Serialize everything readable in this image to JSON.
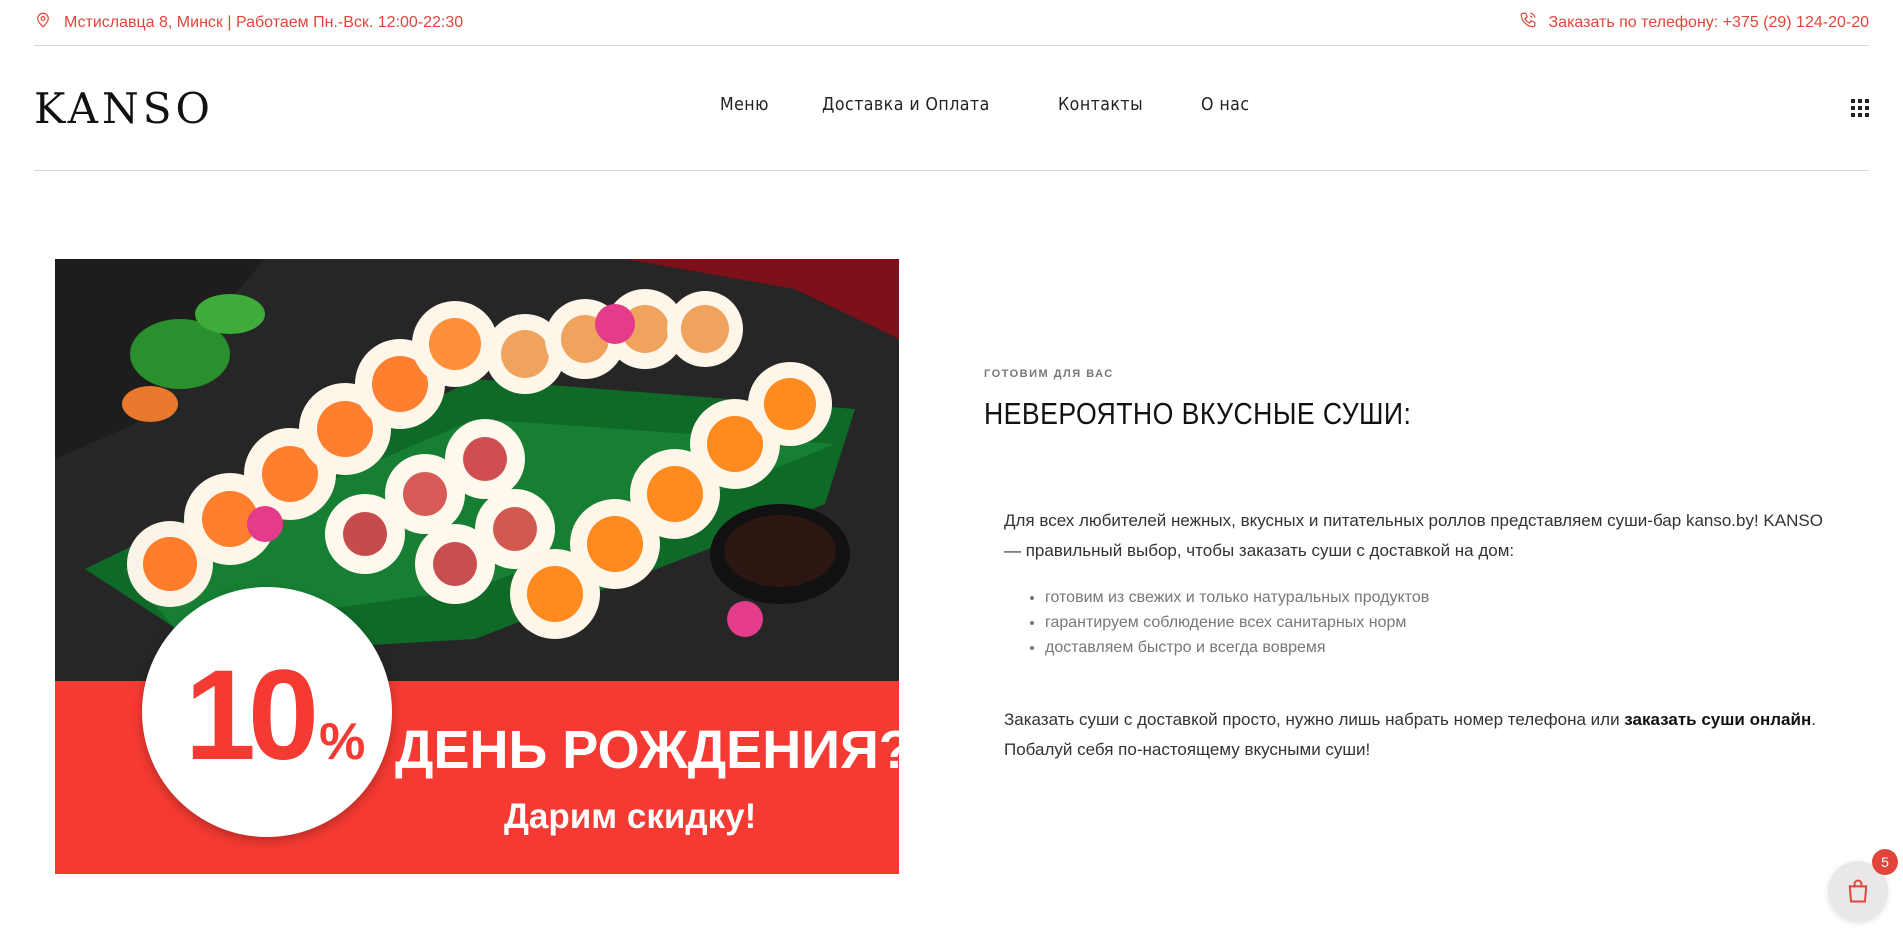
{
  "topbar": {
    "address": "Мстиславца 8, Минск | Работаем Пн.-Вск. 12:00-22:30",
    "phone_text": "Заказать по телефону: +375 (29) 124-20-20",
    "address_icon": "location-pin-icon",
    "phone_icon": "phone-icon",
    "accent_color": "#e0463b"
  },
  "header": {
    "logo": "KANSO",
    "nav": [
      "Меню",
      "Доставка и Оплата",
      "Контакты",
      "О нас"
    ],
    "menu_icon": "grid-menu-icon"
  },
  "promo": {
    "percent": "10",
    "percent_sign": "%",
    "headline": "ДЕНЬ РОЖДЕНИЯ?",
    "subline": "Дарим скидку!",
    "band_color": "#f43a32"
  },
  "content": {
    "kicker": "ГОТОВИМ ДЛЯ ВАС",
    "title": "НЕВЕРОЯТНО ВКУСНЫЕ СУШИ:",
    "paragraph_1": "Для всех любителей нежных, вкусных и питательных роллов представляем суши-бар kanso.by! KANSO — правильный выбор, чтобы заказать суши с доставкой на дом:",
    "bullets": [
      "готовим из свежих и только натуральных продуктов",
      "гарантируем соблюдение всех санитарных норм",
      "доставляем быстро и всегда вовремя"
    ],
    "paragraph_2_before": "Заказать суши с доставкой просто, нужно лишь набрать номер телефона или ",
    "paragraph_2_link": "заказать суши онлайн",
    "paragraph_2_after": ". Побалуй себя по-настоящему вкусными суши!"
  },
  "cart": {
    "icon": "shopping-bag-icon",
    "count": "5"
  }
}
